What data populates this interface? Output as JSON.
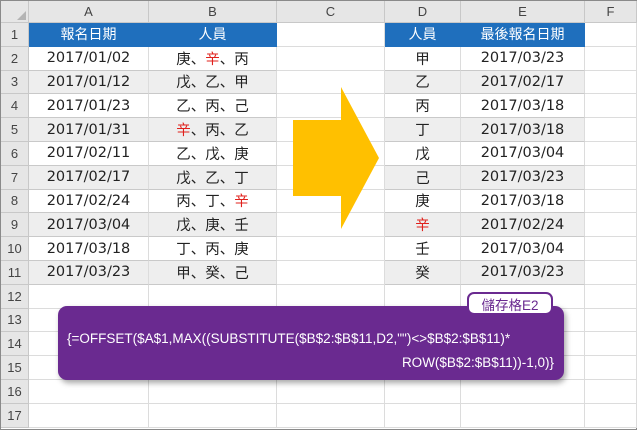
{
  "columns": [
    "A",
    "B",
    "C",
    "D",
    "E",
    "F"
  ],
  "rows": [
    "1",
    "2",
    "3",
    "4",
    "5",
    "6",
    "7",
    "8",
    "9",
    "10",
    "11",
    "12",
    "13",
    "14",
    "15",
    "16",
    "17"
  ],
  "left_table": {
    "headers": [
      "報名日期",
      "人員"
    ],
    "rows": [
      {
        "date": "2017/01/02",
        "people": [
          {
            "t": "庚"
          },
          {
            "t": "辛",
            "red": true
          },
          {
            "t": "丙"
          }
        ]
      },
      {
        "date": "2017/01/12",
        "people": [
          {
            "t": "戊"
          },
          {
            "t": "乙"
          },
          {
            "t": "甲"
          }
        ]
      },
      {
        "date": "2017/01/23",
        "people": [
          {
            "t": "乙"
          },
          {
            "t": "丙"
          },
          {
            "t": "己"
          }
        ]
      },
      {
        "date": "2017/01/31",
        "people": [
          {
            "t": "辛",
            "red": true
          },
          {
            "t": "丙"
          },
          {
            "t": "乙"
          }
        ]
      },
      {
        "date": "2017/02/11",
        "people": [
          {
            "t": "乙"
          },
          {
            "t": "戊"
          },
          {
            "t": "庚"
          }
        ]
      },
      {
        "date": "2017/02/17",
        "people": [
          {
            "t": "戊"
          },
          {
            "t": "乙"
          },
          {
            "t": "丁"
          }
        ]
      },
      {
        "date": "2017/02/24",
        "people": [
          {
            "t": "丙"
          },
          {
            "t": "丁"
          },
          {
            "t": "辛",
            "red": true
          }
        ]
      },
      {
        "date": "2017/03/04",
        "people": [
          {
            "t": "戊"
          },
          {
            "t": "庚"
          },
          {
            "t": "壬"
          }
        ]
      },
      {
        "date": "2017/03/18",
        "people": [
          {
            "t": "丁"
          },
          {
            "t": "丙"
          },
          {
            "t": "庚"
          }
        ]
      },
      {
        "date": "2017/03/23",
        "people": [
          {
            "t": "甲"
          },
          {
            "t": "癸"
          },
          {
            "t": "己"
          }
        ]
      }
    ]
  },
  "separator": "、",
  "right_table": {
    "headers": [
      "人員",
      "最後報名日期"
    ],
    "rows": [
      {
        "person": "甲",
        "date": "2017/03/23"
      },
      {
        "person": "乙",
        "date": "2017/02/17"
      },
      {
        "person": "丙",
        "date": "2017/03/18"
      },
      {
        "person": "丁",
        "date": "2017/03/18"
      },
      {
        "person": "戊",
        "date": "2017/03/04"
      },
      {
        "person": "己",
        "date": "2017/03/23"
      },
      {
        "person": "庚",
        "date": "2017/03/18"
      },
      {
        "person": "辛",
        "date": "2017/02/24",
        "red": true
      },
      {
        "person": "壬",
        "date": "2017/03/04"
      },
      {
        "person": "癸",
        "date": "2017/03/23"
      }
    ]
  },
  "formula": {
    "tag": "儲存格E2",
    "line1": "{=OFFSET($A$1,MAX((SUBSTITUTE($B$2:$B$11,D2,\"\")<>$B$2:$B$11)*",
    "line2": "ROW($B$2:$B$11))-1,0)}"
  },
  "colors": {
    "header_bg": "#1f6fbd",
    "stripe_bg": "#eeeeee",
    "highlight_red": "#e0201b",
    "arrow_fill": "#ffc000",
    "formula_bg": "#6a2a90"
  }
}
